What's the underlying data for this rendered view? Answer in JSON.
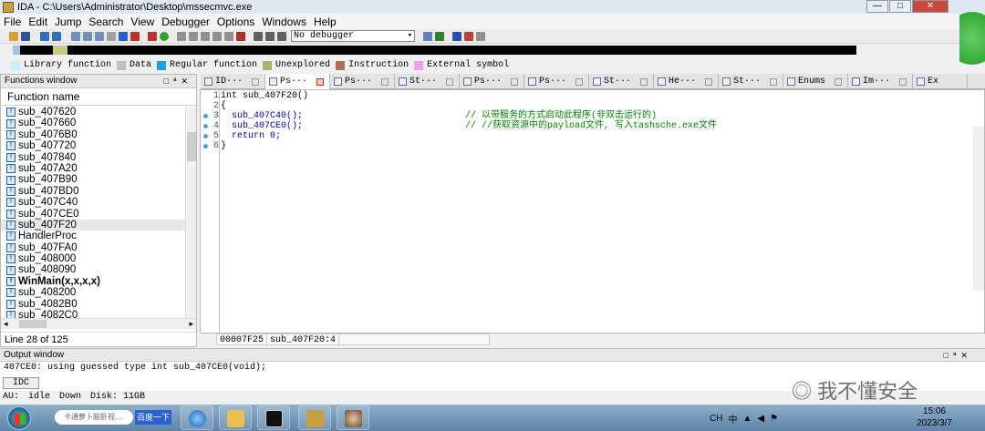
{
  "window": {
    "title": "IDA - C:\\Users\\Administrator\\Desktop\\mssecmvc.exe"
  },
  "menu": [
    "File",
    "Edit",
    "Jump",
    "Search",
    "View",
    "Debugger",
    "Options",
    "Windows",
    "Help"
  ],
  "toolbar": {
    "debugger_select": "No debugger"
  },
  "legend": [
    {
      "label": "Library function",
      "color": "#c8f0f8"
    },
    {
      "label": "Data",
      "color": "#c0c0c0"
    },
    {
      "label": "Regular function",
      "color": "#1f9ee8"
    },
    {
      "label": "Unexplored",
      "color": "#b0b070"
    },
    {
      "label": "Instruction",
      "color": "#b07050"
    },
    {
      "label": "External symbol",
      "color": "#f0a0f0"
    }
  ],
  "functions_window": {
    "title": "Functions window",
    "column": "Function name",
    "items": [
      "sub_407620",
      "sub_407660",
      "sub_4076B0",
      "sub_407720",
      "sub_407840",
      "sub_407A20",
      "sub_407B90",
      "sub_407BD0",
      "sub_407C40",
      "sub_407CE0",
      "sub_407F20",
      "HandlerProc",
      "sub_407FA0",
      "sub_408000",
      "sub_408090",
      "WinMain(x,x,x,x)",
      "sub_408200",
      "sub_4082B0",
      "sub_4082C0"
    ],
    "status": "Line 28 of 125"
  },
  "tabs": [
    {
      "label": "ID···"
    },
    {
      "label": "Ps···"
    },
    {
      "label": "Ps···"
    },
    {
      "label": "St···"
    },
    {
      "label": "Ps···"
    },
    {
      "label": "Ps···"
    },
    {
      "label": "St···"
    },
    {
      "label": "He···"
    },
    {
      "label": "St···"
    },
    {
      "label": "Enums"
    },
    {
      "label": "Im···"
    },
    {
      "label": "Ex"
    }
  ],
  "code": {
    "lines": [
      {
        "num": "1",
        "text": "int sub_407F20()",
        "comment": ""
      },
      {
        "num": "2",
        "text": "{",
        "comment": ""
      },
      {
        "num": "3",
        "text": "  sub_407C40();",
        "comment": "// 以带服务的方式启动此程序(非双击运行的)"
      },
      {
        "num": "4",
        "text": "  sub_407CE0();",
        "comment": "// //获取资源中的payload文件, 写入tashsche.exe文件"
      },
      {
        "num": "5",
        "text": "  return 0;",
        "comment": ""
      },
      {
        "num": "6",
        "text": "}",
        "comment": ""
      }
    ],
    "status_addr": "00007F25",
    "status_loc": "sub_407F20:4"
  },
  "output_window": {
    "title": "Output window",
    "text": "407CE0: using guessed type int sub_407CE0(void);",
    "idc_button": "IDC"
  },
  "status_bar": {
    "au": "AU:",
    "state": "idle",
    "dir": "Down",
    "disk": "Disk: 11GB"
  },
  "taskbar": {
    "search_placeholder": "卡通萝卜脑卧视…",
    "search_button": "百度一下",
    "tray_lang": "CH",
    "time": "15:06",
    "date": "2023/3/7"
  },
  "watermark": "我不懂安全"
}
